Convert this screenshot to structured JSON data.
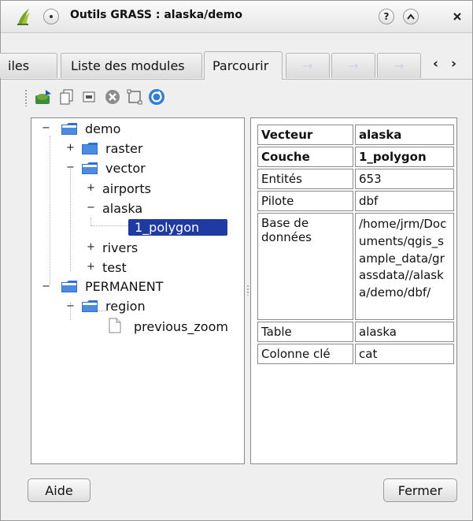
{
  "window": {
    "title": "Outils GRASS : alaska/demo",
    "help_button": "?",
    "rollup_button": "^",
    "close_button": "×"
  },
  "tabs": [
    {
      "label": "iles",
      "active": false
    },
    {
      "label": "Liste des modules",
      "active": false
    },
    {
      "label": "Parcourir",
      "active": true
    },
    {
      "label": "→",
      "active": false
    },
    {
      "label": "→",
      "active": false
    },
    {
      "label": "→",
      "active": false
    }
  ],
  "tab_scroll": {
    "left": "‹",
    "right": "›"
  },
  "toolbar": {
    "icons": [
      "add-map-icon",
      "copy-map-icon",
      "rename-map-icon",
      "delete-map-icon",
      "set-region-icon",
      "refresh-icon"
    ]
  },
  "tree": {
    "demo": "demo",
    "raster": "raster",
    "vector": "vector",
    "airports": "airports",
    "alaska": "alaska",
    "layer": "1_polygon",
    "rivers": "rivers",
    "test": "test",
    "permanent": "PERMANENT",
    "region": "region",
    "previous_zoom": "previous_zoom",
    "expanders": {
      "minus": "−",
      "plus": "+"
    }
  },
  "info": {
    "rows": [
      {
        "key": "Vecteur",
        "value": "alaska"
      },
      {
        "key": "Couche",
        "value": "1_polygon"
      },
      {
        "key": "Entités",
        "value": "653"
      },
      {
        "key": "Pilote",
        "value": "dbf"
      },
      {
        "key": "Base de données",
        "value": "/home/jrm/Documents/qgis_sample_data/grassdata//alaska/demo/dbf/"
      },
      {
        "key": "Table",
        "value": "alaska"
      },
      {
        "key": "Colonne clé",
        "value": "cat"
      }
    ]
  },
  "buttons": {
    "help": "Aide",
    "close": "Fermer"
  },
  "colors": {
    "selection": "#1f3aa0",
    "folder": "#2e6fcf",
    "window_bg": "#efefef"
  }
}
